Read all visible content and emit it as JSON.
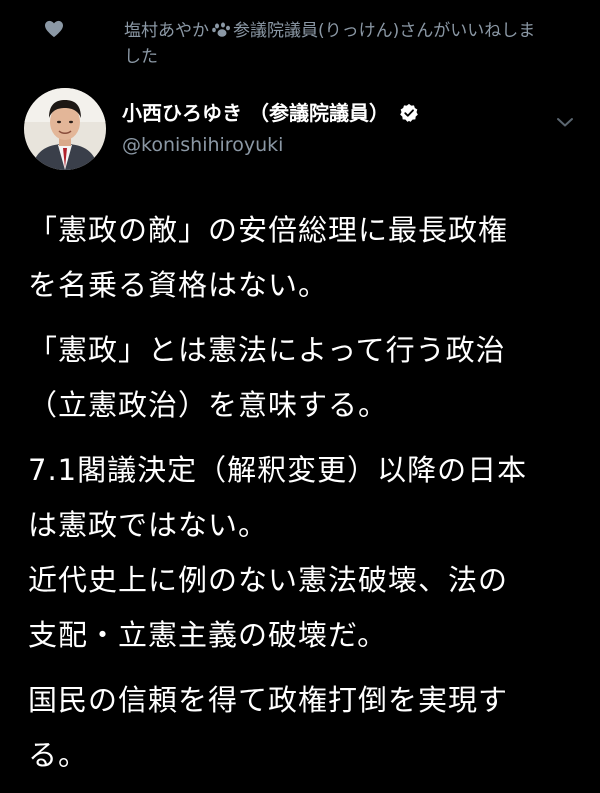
{
  "social_context": {
    "liker_name": "塩村あやか",
    "liked_text": "参議院議員(りっけん)さんがいいねしました"
  },
  "author": {
    "display_name": "小西ひろゆき （参議院議員）",
    "handle": "@konishihiroyuki"
  },
  "tweet": {
    "paragraphs": [
      "「憲政の敵」の安倍総理に最長政権\nを名乗る資格はない。",
      "「憲政」とは憲法によって行う政治\n（立憲政治）を意味する。",
      "7.1閣議決定（解釈変更）以降の日本\nは憲政ではない。\n近代史上に例のない憲法破壊、法の\n支配・立憲主義の破壊だ。",
      "国民の信頼を得て政権打倒を実現す\nる。"
    ]
  },
  "icons": {
    "heart": "heart-icon",
    "paw": "paw-icon",
    "verified": "verified-icon",
    "chevron": "chevron-down-icon"
  },
  "colors": {
    "background": "#000000",
    "text": "#ffffff",
    "secondary": "#8b98a5"
  }
}
